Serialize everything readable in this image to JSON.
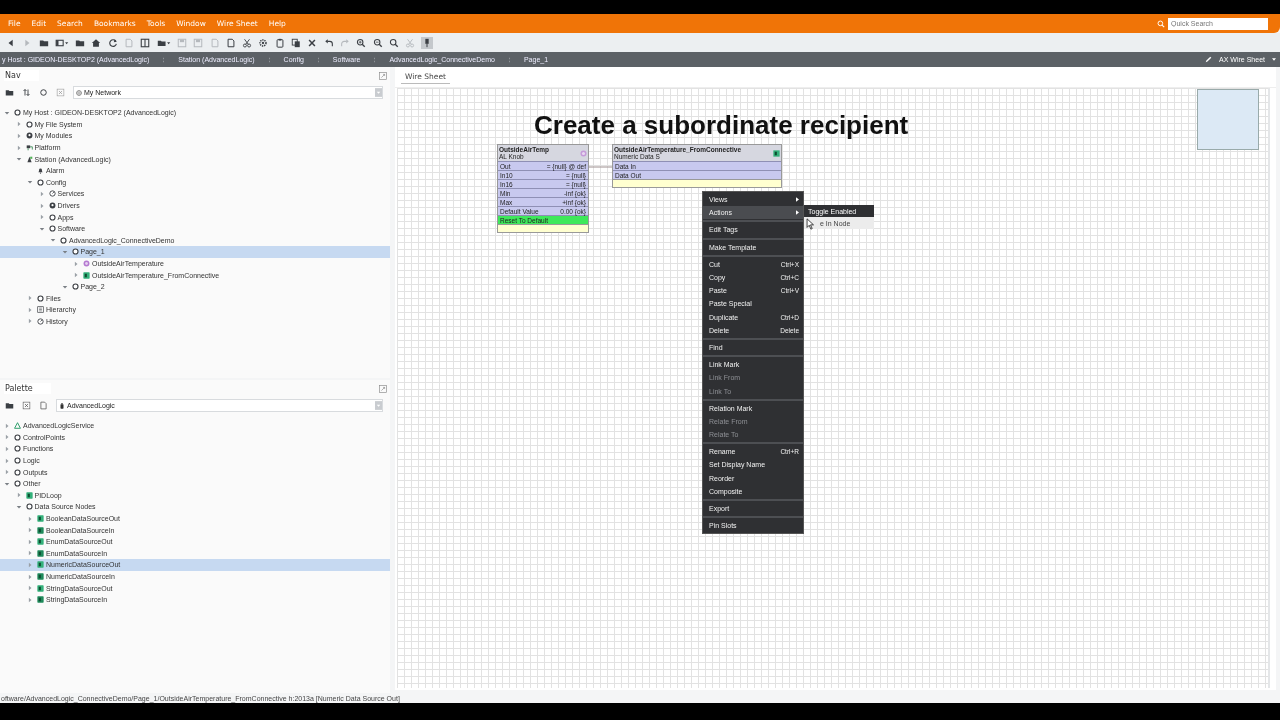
{
  "menu_bar": {
    "items": [
      "File",
      "Edit",
      "Search",
      "Bookmarks",
      "Tools",
      "Window",
      "Wire Sheet",
      "Help"
    ],
    "quick_search": {
      "placeholder": "Quick Search"
    }
  },
  "toolbar": [
    {
      "kind": "back",
      "disabled": false
    },
    {
      "kind": "forward",
      "disabled": true
    },
    {
      "kind": "folder",
      "disabled": false
    },
    {
      "kind": "window-dropdown",
      "disabled": false
    },
    {
      "kind": "folder",
      "disabled": false
    },
    {
      "kind": "home",
      "disabled": false
    },
    {
      "kind": "refresh",
      "disabled": false
    },
    {
      "kind": "document",
      "disabled": true
    },
    {
      "kind": "columns",
      "disabled": false
    },
    {
      "kind": "folder-dropdown",
      "disabled": false
    },
    {
      "kind": "save",
      "disabled": true
    },
    {
      "kind": "save",
      "disabled": true
    },
    {
      "kind": "document",
      "disabled": true
    },
    {
      "kind": "document",
      "disabled": false
    },
    {
      "kind": "cut",
      "disabled": false
    },
    {
      "kind": "gear",
      "disabled": false
    },
    {
      "kind": "paste",
      "disabled": false
    },
    {
      "kind": "copy",
      "disabled": false
    },
    {
      "kind": "delete",
      "disabled": false
    },
    {
      "kind": "undo",
      "disabled": false
    },
    {
      "kind": "redo",
      "disabled": true
    },
    {
      "kind": "zoom-in",
      "disabled": false
    },
    {
      "kind": "zoom-out",
      "disabled": false
    },
    {
      "kind": "search",
      "disabled": false
    },
    {
      "kind": "cut",
      "disabled": true
    },
    {
      "kind": "pin",
      "disabled": false
    }
  ],
  "breadcrumbs": [
    "y Host : GIDEON-DESKTOP2 (AdvancedLogic)",
    "Station (AdvancedLogic)",
    "Config",
    "Software",
    "AdvancedLogic_ConnectiveDemo",
    "Page_1"
  ],
  "view_selector": "AX Wire Sheet",
  "nav": {
    "title": "Nav",
    "location": "My Network",
    "tree": [
      {
        "label": "My Host : GIDEON-DESKTOP2 (AdvancedLogic)",
        "kind": "folder",
        "expanded": true,
        "selected": false,
        "children": [
          {
            "label": "My File System",
            "kind": "folder",
            "expanded": false,
            "selected": false
          },
          {
            "label": "My Modules",
            "kind": "modules",
            "expanded": false,
            "selected": false
          },
          {
            "label": "Platform",
            "kind": "platform",
            "expanded": false,
            "selected": false
          },
          {
            "label": "Station (AdvancedLogic)",
            "kind": "station",
            "expanded": true,
            "selected": false,
            "children": [
              {
                "label": "Alarm",
                "kind": "alarm",
                "selected": false
              },
              {
                "label": "Config",
                "kind": "folder",
                "expanded": true,
                "selected": false,
                "children": [
                  {
                    "label": "Services",
                    "kind": "services",
                    "expanded": false,
                    "selected": false
                  },
                  {
                    "label": "Drivers",
                    "kind": "modules",
                    "expanded": false,
                    "selected": false
                  },
                  {
                    "label": "Apps",
                    "kind": "folder",
                    "expanded": false,
                    "selected": false
                  },
                  {
                    "label": "Software",
                    "kind": "folder",
                    "expanded": true,
                    "selected": false,
                    "children": [
                      {
                        "label": "AdvancedLogic_ConnectiveDemo",
                        "kind": "folder",
                        "expanded": true,
                        "selected": false,
                        "children": [
                          {
                            "label": "Page_1",
                            "kind": "folder",
                            "expanded": true,
                            "selected": true,
                            "children": [
                              {
                                "label": "OutsideAirTemperature",
                                "kind": "knob",
                                "expanded": false,
                                "selected": false
                              },
                              {
                                "label": "OutsideAirTemperature_FromConnective",
                                "kind": "node-out",
                                "expanded": false,
                                "selected": false
                              }
                            ]
                          },
                          {
                            "label": "Page_2",
                            "kind": "folder",
                            "expanded": true,
                            "selected": false
                          }
                        ]
                      }
                    ]
                  }
                ]
              },
              {
                "label": "Files",
                "kind": "folder",
                "expanded": false,
                "selected": false
              },
              {
                "label": "Hierarchy",
                "kind": "hierarchy",
                "expanded": false,
                "selected": false
              },
              {
                "label": "History",
                "kind": "services",
                "expanded": false,
                "selected": false
              }
            ]
          }
        ]
      }
    ]
  },
  "palette": {
    "title": "Palette",
    "module": "AdvancedLogic",
    "tree": [
      {
        "label": "AdvancedLogicService",
        "kind": "service",
        "expanded": false,
        "selected": false
      },
      {
        "label": "ControlPoints",
        "kind": "folder",
        "expanded": false,
        "selected": false
      },
      {
        "label": "Functions",
        "kind": "folder",
        "expanded": false,
        "selected": false
      },
      {
        "label": "Logic",
        "kind": "folder",
        "expanded": false,
        "selected": false
      },
      {
        "label": "Outputs",
        "kind": "folder",
        "expanded": false,
        "selected": false
      },
      {
        "label": "Other",
        "kind": "folder",
        "expanded": true,
        "selected": false,
        "children": [
          {
            "label": "PIDLoop",
            "kind": "pid",
            "expanded": false,
            "selected": false
          },
          {
            "label": "Data Source Nodes",
            "kind": "folder",
            "expanded": true,
            "selected": false,
            "children": [
              {
                "label": "BooleanDataSourceOut",
                "kind": "node-out",
                "expanded": false,
                "selected": false
              },
              {
                "label": "BooleanDataSourceIn",
                "kind": "node-in",
                "expanded": false,
                "selected": false
              },
              {
                "label": "EnumDataSourceOut",
                "kind": "node-out",
                "expanded": false,
                "selected": false
              },
              {
                "label": "EnumDataSourceIn",
                "kind": "node-in",
                "expanded": false,
                "selected": false
              },
              {
                "label": "NumericDataSourceOut",
                "kind": "node-out",
                "expanded": false,
                "selected": true
              },
              {
                "label": "NumericDataSourceIn",
                "kind": "node-in",
                "expanded": false,
                "selected": false
              },
              {
                "label": "StringDataSourceOut",
                "kind": "node-out",
                "expanded": false,
                "selected": false
              },
              {
                "label": "StringDataSourceIn",
                "kind": "node-in",
                "expanded": false,
                "selected": false
              }
            ]
          }
        ]
      }
    ]
  },
  "wire_sheet": {
    "tab": "Wire Sheet",
    "caption": "Create a subordinate recipient",
    "nodes": [
      {
        "kind": "knob",
        "title": "OutsideAirTemp",
        "type": "AL Knob",
        "slots": [
          {
            "kind": "slot",
            "name": "Out",
            "value": "= {null} @ def"
          },
          {
            "kind": "slot",
            "name": "In10",
            "value": "= {null}"
          },
          {
            "kind": "slot",
            "name": "In16",
            "value": "= {null}"
          },
          {
            "kind": "slot",
            "name": "Min",
            "value": "-inf {ok}"
          },
          {
            "kind": "slot",
            "name": "Max",
            "value": "+inf {ok}"
          },
          {
            "kind": "slot",
            "name": "Default Value",
            "value": "0.00 {ok}"
          },
          {
            "kind": "action",
            "name": "Reset To Default"
          }
        ]
      },
      {
        "kind": "data-source",
        "title": "OutsideAirTemperature_FromConnective",
        "type": "Numeric Data S",
        "slots": [
          {
            "kind": "slot",
            "name": "Data In"
          },
          {
            "kind": "slot",
            "name": "Data Out"
          }
        ]
      }
    ],
    "context_menu": {
      "items": [
        {
          "kind": "item",
          "label": "Views",
          "submenu": true,
          "selected": false,
          "disabled": false
        },
        {
          "kind": "item",
          "label": "Actions",
          "submenu": true,
          "selected": true,
          "disabled": false
        },
        {
          "kind": "separator"
        },
        {
          "kind": "item",
          "label": "Edit Tags",
          "submenu": false,
          "selected": false,
          "disabled": false
        },
        {
          "kind": "separator"
        },
        {
          "kind": "item",
          "label": "Make Template",
          "submenu": false,
          "selected": false,
          "disabled": false
        },
        {
          "kind": "separator"
        },
        {
          "kind": "item",
          "label": "Cut",
          "shortcut": "Ctrl+X",
          "submenu": false,
          "selected": false,
          "disabled": false
        },
        {
          "kind": "item",
          "label": "Copy",
          "shortcut": "Ctrl+C",
          "submenu": false,
          "selected": false,
          "disabled": false
        },
        {
          "kind": "item",
          "label": "Paste",
          "shortcut": "Ctrl+V",
          "submenu": false,
          "selected": false,
          "disabled": false
        },
        {
          "kind": "item",
          "label": "Paste Special",
          "submenu": false,
          "selected": false,
          "disabled": false
        },
        {
          "kind": "item",
          "label": "Duplicate",
          "shortcut": "Ctrl+D",
          "submenu": false,
          "selected": false,
          "disabled": false
        },
        {
          "kind": "item",
          "label": "Delete",
          "shortcut": "Delete",
          "submenu": false,
          "selected": false,
          "disabled": false
        },
        {
          "kind": "separator"
        },
        {
          "kind": "item",
          "label": "Find",
          "submenu": false,
          "selected": false,
          "disabled": false
        },
        {
          "kind": "separator"
        },
        {
          "kind": "item",
          "label": "Link Mark",
          "submenu": false,
          "selected": false,
          "disabled": false
        },
        {
          "kind": "item",
          "label": "Link From",
          "submenu": false,
          "selected": false,
          "disabled": true
        },
        {
          "kind": "item",
          "label": "Link To",
          "submenu": false,
          "selected": false,
          "disabled": true
        },
        {
          "kind": "separator"
        },
        {
          "kind": "item",
          "label": "Relation Mark",
          "submenu": false,
          "selected": false,
          "disabled": false
        },
        {
          "kind": "item",
          "label": "Relate From",
          "submenu": false,
          "selected": false,
          "disabled": true
        },
        {
          "kind": "item",
          "label": "Relate To",
          "submenu": false,
          "selected": false,
          "disabled": true
        },
        {
          "kind": "separator"
        },
        {
          "kind": "item",
          "label": "Rename",
          "shortcut": "Ctrl+R",
          "submenu": false,
          "selected": false,
          "disabled": false
        },
        {
          "kind": "item",
          "label": "Set Display Name",
          "submenu": false,
          "selected": false,
          "disabled": false
        },
        {
          "kind": "item",
          "label": "Reorder",
          "submenu": false,
          "selected": false,
          "disabled": false
        },
        {
          "kind": "item",
          "label": "Composite",
          "submenu": false,
          "selected": false,
          "disabled": false
        },
        {
          "kind": "separator"
        },
        {
          "kind": "item",
          "label": "Export",
          "submenu": false,
          "selected": false,
          "disabled": false
        },
        {
          "kind": "separator"
        },
        {
          "kind": "item",
          "label": "Pin Slots",
          "submenu": false,
          "selected": false,
          "disabled": false
        }
      ]
    },
    "submenu": {
      "items": [
        {
          "label": "Toggle Enabled",
          "selected": true
        },
        {
          "label": "e In Node",
          "selected": false
        }
      ]
    }
  },
  "status_bar": "oftware/AdvancedLogic_ConnectiveDemo/Page_1/OutsideAirTemperature_FromConnective h:2013a [Numeric Data Source Out]"
}
